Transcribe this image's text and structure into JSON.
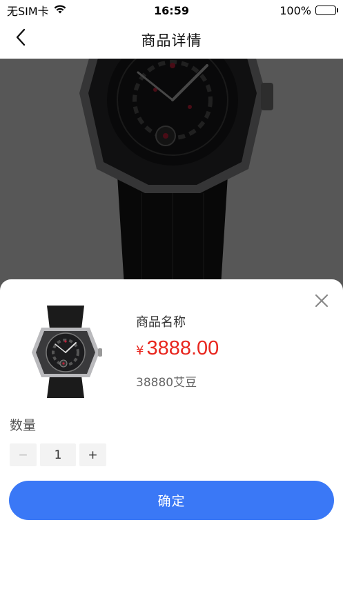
{
  "status_bar": {
    "carrier": "无SIM卡",
    "time": "16:59",
    "battery": "100%"
  },
  "nav": {
    "title": "商品详情"
  },
  "product": {
    "name": "商品名称",
    "currency_symbol": "¥",
    "price": "3888.00",
    "points": "38880艾豆"
  },
  "quantity": {
    "label": "数量",
    "value": "1",
    "decrement": "−",
    "increment": "+"
  },
  "actions": {
    "confirm_label": "确定"
  },
  "colors": {
    "accent": "#3a78f6",
    "price": "#e8261e"
  }
}
